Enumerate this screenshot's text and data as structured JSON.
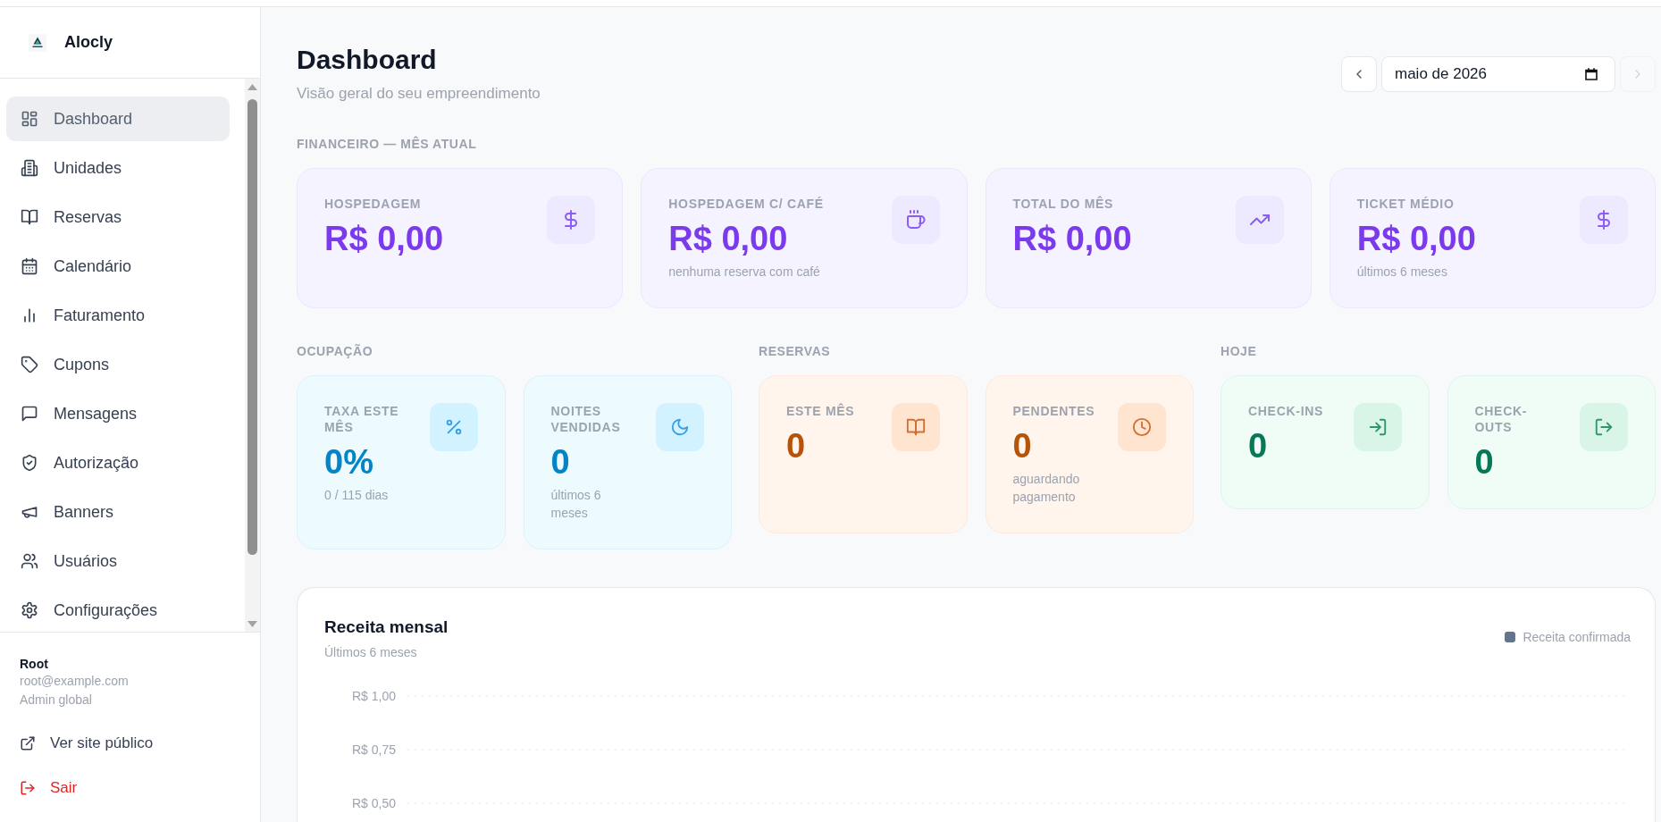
{
  "sidebar": {
    "brand": "Alocly",
    "nav": [
      {
        "label": "Dashboard",
        "selected": true
      },
      {
        "label": "Unidades",
        "selected": false
      },
      {
        "label": "Reservas",
        "selected": false
      },
      {
        "label": "Calendário",
        "selected": false
      },
      {
        "label": "Faturamento",
        "selected": false
      },
      {
        "label": "Cupons",
        "selected": false
      },
      {
        "label": "Mensagens",
        "selected": false
      },
      {
        "label": "Autorização",
        "selected": false
      },
      {
        "label": "Banners",
        "selected": false
      },
      {
        "label": "Usuários",
        "selected": false
      },
      {
        "label": "Configurações",
        "selected": false
      }
    ],
    "user": {
      "name": "Root",
      "email": "root@example.com",
      "role": "Admin global"
    },
    "links": [
      {
        "label": "Ver site público",
        "kind": "external"
      },
      {
        "label": "Sair",
        "kind": "logout"
      }
    ]
  },
  "header": {
    "title": "Dashboard",
    "subtitle": "Visão geral do seu empreendimento",
    "period": {
      "value": "maio de 2026",
      "prev": {
        "disabled": false
      },
      "next": {
        "disabled": true
      }
    }
  },
  "finance": {
    "heading": "FINANCEIRO — MÊS ATUAL",
    "cards": [
      {
        "label": "HOSPEDAGEM",
        "value": "R$ 0,00"
      },
      {
        "label": "HOSPEDAGEM C/ CAFÉ",
        "value": "R$ 0,00",
        "note": "nenhuma reserva com café"
      },
      {
        "label": "TOTAL DO MÊS",
        "value": "R$ 0,00"
      },
      {
        "label": "TICKET MÉDIO",
        "value": "R$ 0,00",
        "note": "últimos 6 meses"
      }
    ]
  },
  "groups": [
    {
      "heading": "OCUPAÇÃO",
      "color": "#0284c7",
      "cards": [
        {
          "label": "TAXA ESTE MÊS",
          "value": "0%",
          "note": "0 / 115 dias"
        },
        {
          "label": "NOITES VENDIDAS",
          "value": "0",
          "note": "últimos 6 meses"
        }
      ]
    },
    {
      "heading": "RESERVAS",
      "color": "#b45309",
      "cards": [
        {
          "label": "ESTE MÊS",
          "value": "0"
        },
        {
          "label": "PENDENTES",
          "value": "0",
          "note": "aguardando pagamento"
        }
      ]
    },
    {
      "heading": "HOJE",
      "color": "#047857",
      "cards": [
        {
          "label": "CHECK-INS",
          "value": "0"
        },
        {
          "label": "CHECK-OUTS",
          "value": "0"
        }
      ]
    }
  ],
  "revenue_chart": {
    "title": "Receita mensal",
    "subtitle": "Últimos 6 meses",
    "legend": [
      {
        "name": "Receita confirmada",
        "color": "#64748b"
      }
    ],
    "axis_labels": [
      "R$ 1,00",
      "R$ 0,75",
      "R$ 0,50"
    ]
  }
}
